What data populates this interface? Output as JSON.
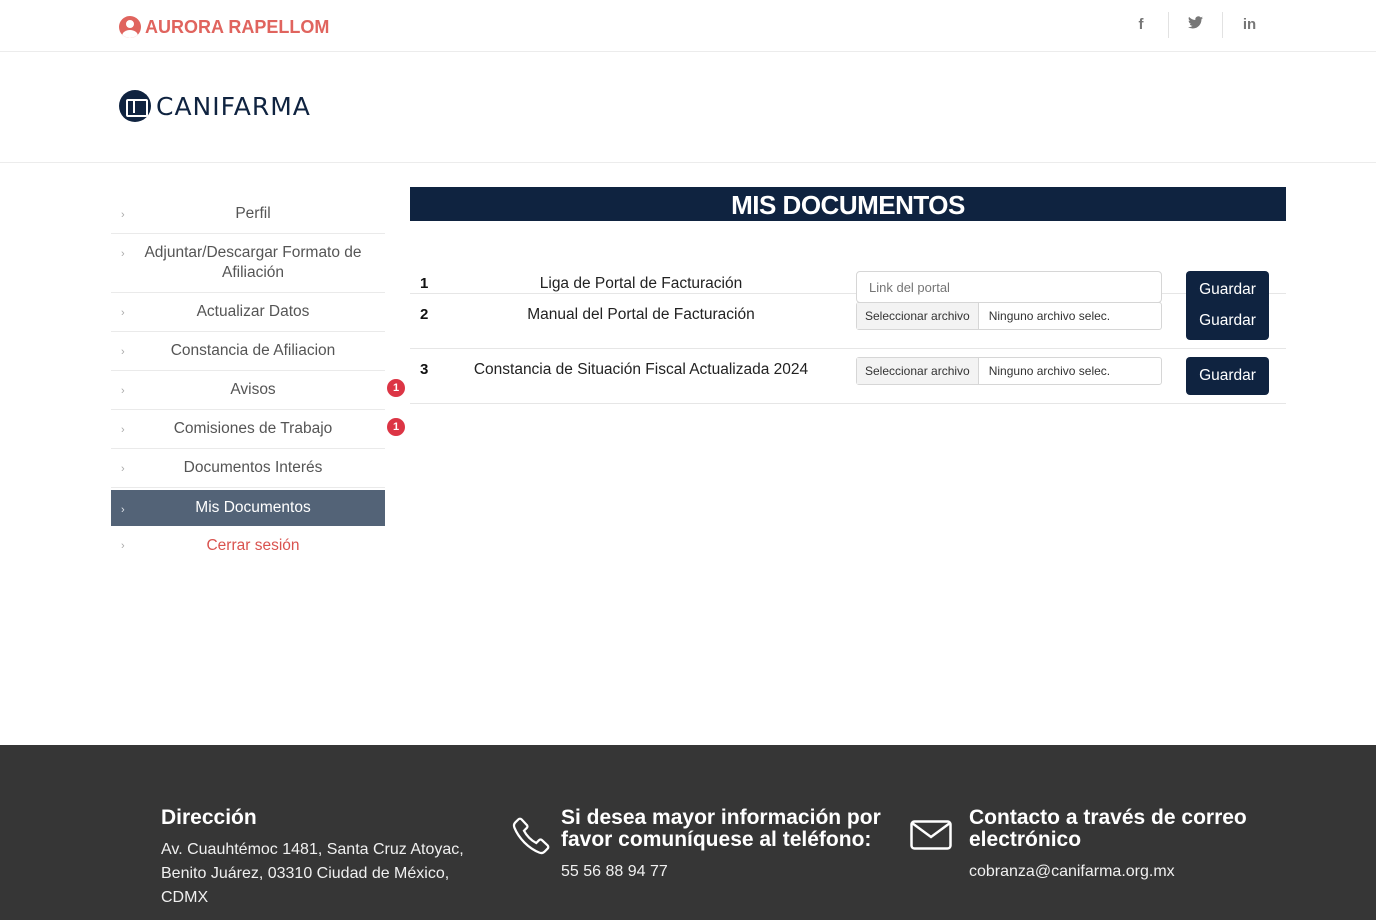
{
  "topbar": {
    "user_name": "AURORA RAPELLOM",
    "social": [
      {
        "icon": "facebook-icon",
        "glyph": "f"
      },
      {
        "icon": "twitter-icon",
        "glyph": "🐦"
      },
      {
        "icon": "linkedin-icon",
        "glyph": "in"
      }
    ]
  },
  "header": {
    "logo_text": "CANIFARMA"
  },
  "sidebar": {
    "items": [
      {
        "label": "Perfil"
      },
      {
        "label": "Adjuntar/Descargar Formato de Afiliación"
      },
      {
        "label": "Actualizar Datos"
      },
      {
        "label": "Constancia de Afiliacion"
      },
      {
        "label": "Avisos",
        "badge": "1"
      },
      {
        "label": "Comisiones de Trabajo",
        "badge": "1"
      },
      {
        "label": "Documentos Interés"
      },
      {
        "label": "Mis Documentos",
        "active": true
      },
      {
        "label": "Cerrar sesión"
      }
    ]
  },
  "main": {
    "title": "MIS DOCUMENTOS",
    "rows": [
      {
        "num": "1",
        "name": "Liga de Portal de Facturación",
        "input_placeholder": "Link del portal",
        "button": "Guardar"
      },
      {
        "num": "2",
        "name": "Manual del Portal de Facturación",
        "file_button": "Seleccionar archivo",
        "file_text": "Ninguno archivo selec.",
        "button": "Guardar"
      },
      {
        "num": "3",
        "name": "Constancia de Situación Fiscal Actualizada 2024",
        "file_button": "Seleccionar archivo",
        "file_text": "Ninguno archivo selec.",
        "button": "Guardar"
      }
    ]
  },
  "footer": {
    "address": {
      "title": "Dirección",
      "lines": [
        "Av. Cuauhtémoc 1481, Santa Cruz Atoyac,",
        "Benito Juárez, 03310 Ciudad de México,",
        "CDMX"
      ]
    },
    "phone": {
      "title_lines": [
        "Si desea mayor información por",
        "favor comuníquese al teléfono:"
      ],
      "number": "55 56 88 94 77"
    },
    "email": {
      "title_lines": [
        "Contacto a través de correo",
        "electrónico"
      ],
      "address": "cobranza@canifarma.org.mx"
    }
  },
  "colors": {
    "brand_navy": "#0f2340",
    "user_red": "#e0645e",
    "sidebar_active": "#536377",
    "badge_red": "#dc3545",
    "footer_bg": "#363636"
  }
}
